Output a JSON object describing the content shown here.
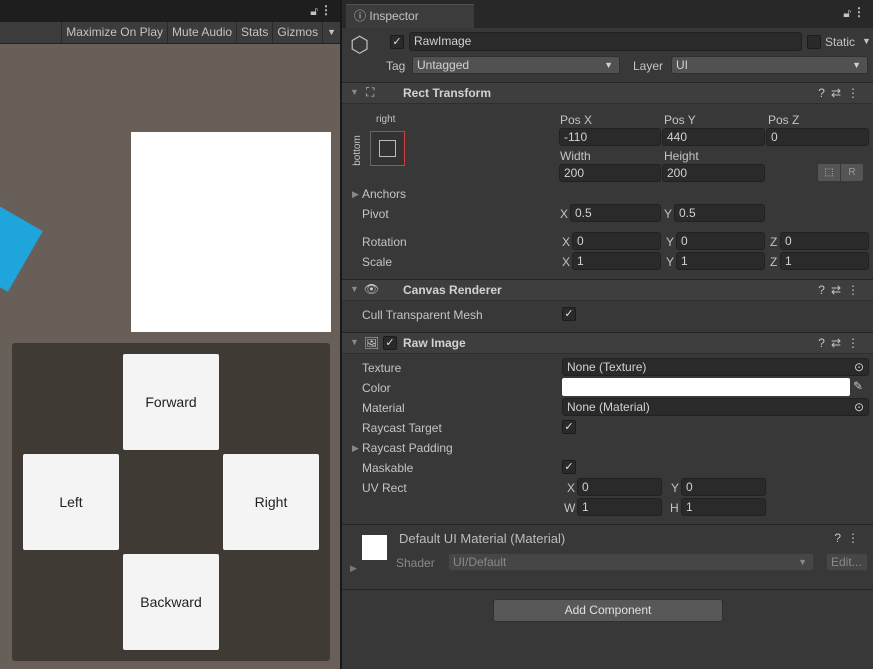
{
  "game_view": {
    "toolbar": [
      "Maximize On Play",
      "Mute Audio",
      "Stats",
      "Gizmos"
    ],
    "buttons": {
      "forward": "Forward",
      "left": "Left",
      "right": "Right",
      "backward": "Backward"
    }
  },
  "inspector": {
    "tab_label": "Inspector",
    "object": {
      "name": "RawImage",
      "static_label": "Static",
      "tag_label": "Tag",
      "tag_value": "Untagged",
      "layer_label": "Layer",
      "layer_value": "UI"
    },
    "rect_transform": {
      "title": "Rect Transform",
      "anchor_h": "right",
      "anchor_v": "bottom",
      "pos_x_label": "Pos X",
      "pos_y_label": "Pos Y",
      "pos_z_label": "Pos Z",
      "pos_x": "-110",
      "pos_y": "440",
      "pos_z": "0",
      "width_label": "Width",
      "height_label": "Height",
      "width": "200",
      "height": "200",
      "r_label": "R",
      "anchors_label": "Anchors",
      "pivot_label": "Pivot",
      "pivot_x": "0.5",
      "pivot_y": "0.5",
      "rotation_label": "Rotation",
      "rot_x": "0",
      "rot_y": "0",
      "rot_z": "0",
      "scale_label": "Scale",
      "scale_x": "1",
      "scale_y": "1",
      "scale_z": "1",
      "x": "X",
      "y": "Y",
      "z": "Z",
      "w": "W",
      "h": "H"
    },
    "canvas_renderer": {
      "title": "Canvas Renderer",
      "cull_label": "Cull Transparent Mesh"
    },
    "raw_image": {
      "title": "Raw Image",
      "texture_label": "Texture",
      "texture_value": "None (Texture)",
      "color_label": "Color",
      "color_value": "#ffffff",
      "material_label": "Material",
      "material_value": "None (Material)",
      "raycast_target_label": "Raycast Target",
      "raycast_padding_label": "Raycast Padding",
      "maskable_label": "Maskable",
      "uv_rect_label": "UV Rect",
      "uv_x": "0",
      "uv_y": "0",
      "uv_w": "1",
      "uv_h": "1"
    },
    "material": {
      "title": "Default UI Material (Material)",
      "shader_label": "Shader",
      "shader_value": "UI/Default",
      "edit_label": "Edit..."
    },
    "add_component_label": "Add Component"
  }
}
